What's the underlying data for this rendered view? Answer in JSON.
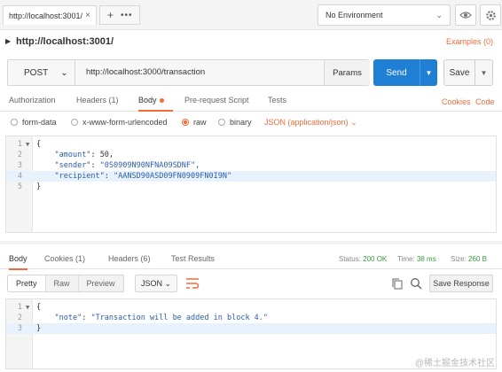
{
  "tabbar": {
    "request_tab_title": "http://localhost:3001/",
    "close_glyph": "×",
    "new_tab_glyph": "+",
    "more_glyph": "•••",
    "environment": "No Environment"
  },
  "request": {
    "name": "http://localhost:3001/",
    "examples_label": "Examples (0)",
    "method": "POST",
    "url": "http://localhost:3000/transaction",
    "params_label": "Params",
    "send_label": "Send",
    "save_label": "Save"
  },
  "request_tabs": {
    "authorization": "Authorization",
    "headers": "Headers (1)",
    "body": "Body",
    "pre_request": "Pre-request Script",
    "tests": "Tests",
    "cookies": "Cookies",
    "code": "Code"
  },
  "body_types": {
    "form_data": "form-data",
    "urlencoded": "x-www-form-urlencoded",
    "raw": "raw",
    "binary": "binary",
    "json_select": "JSON (application/json)",
    "selected": "raw"
  },
  "request_body": {
    "lines": [
      {
        "num": "1",
        "text": "{"
      },
      {
        "num": "2",
        "key": "\"amount\"",
        "sep": ": ",
        "value": "50,"
      },
      {
        "num": "3",
        "key": "\"sender\"",
        "sep": ": ",
        "value": "\"0S0909N90NFNA09SDNF\","
      },
      {
        "num": "4",
        "key": "\"recipient\"",
        "sep": ": ",
        "value": "\"AANSD90ASD09FN0909FN0I9N\""
      },
      {
        "num": "5",
        "text": "}"
      }
    ]
  },
  "response_tabs": {
    "body": "Body",
    "cookies": "Cookies (1)",
    "headers": "Headers (6)",
    "test_results": "Test Results"
  },
  "response_status": {
    "status_label": "Status:",
    "status_value": "200 OK",
    "time_label": "Time:",
    "time_value": "38 ms",
    "size_label": "Size:",
    "size_value": "260 B"
  },
  "response_tools": {
    "pretty": "Pretty",
    "raw": "Raw",
    "preview": "Preview",
    "format": "JSON",
    "save_response": "Save Response"
  },
  "response_body": {
    "lines": [
      {
        "num": "1",
        "text": "{"
      },
      {
        "num": "2",
        "key": "\"note\"",
        "sep": ": ",
        "value": "\"Transaction will be added in block 4.\""
      },
      {
        "num": "3",
        "text": "}"
      }
    ]
  },
  "watermark": "@稀土掘金技术社区",
  "colors": {
    "accent": "#f26b3a",
    "send_button": "#1f7fd4",
    "status_ok": "#3a9a3a"
  }
}
